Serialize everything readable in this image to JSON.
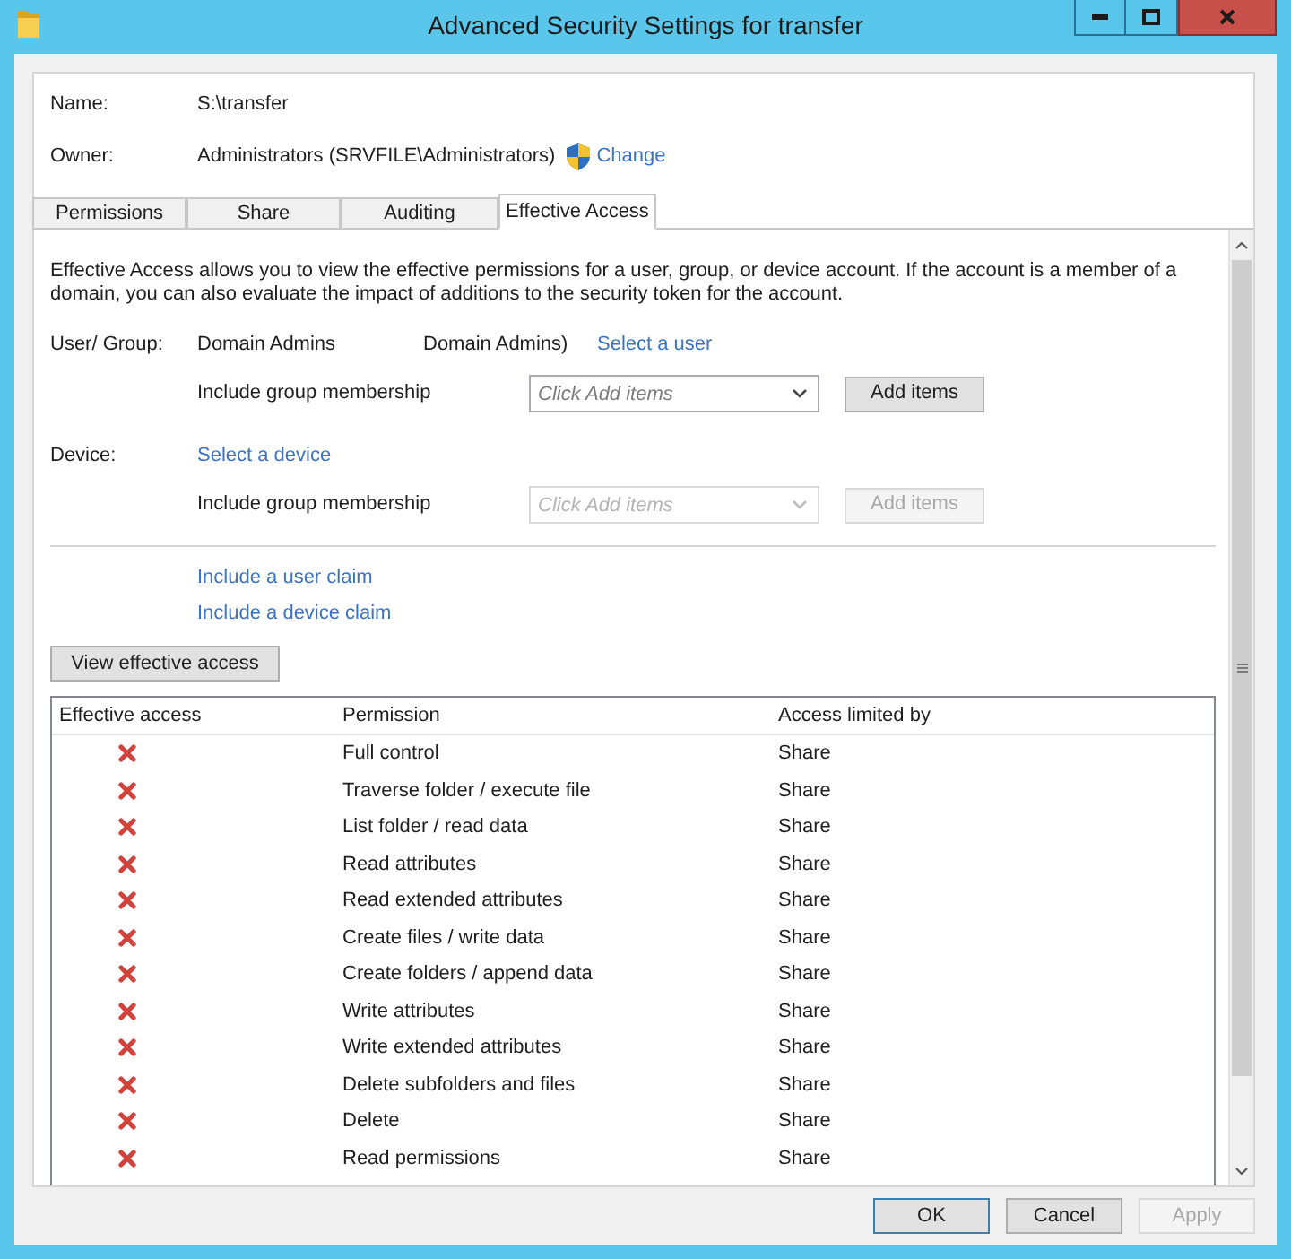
{
  "window": {
    "title": "Advanced Security Settings for transfer"
  },
  "object": {
    "name_label": "Name:",
    "name_value": "S:\\transfer",
    "owner_label": "Owner:",
    "owner_value": "Administrators (SRVFILE\\Administrators)",
    "change_link": "Change"
  },
  "tabs": [
    {
      "label": "Permissions",
      "selected": false
    },
    {
      "label": "Share",
      "selected": false
    },
    {
      "label": "Auditing",
      "selected": false
    },
    {
      "label": "Effective Access",
      "selected": true
    }
  ],
  "effective_access": {
    "description": "Effective Access allows you to view the effective permissions for a user, group, or device account. If the account is a member of a domain, you can also evaluate the impact of additions to the security token for the account.",
    "principals": [
      {
        "label": "User/ Group:",
        "value": "Domain Admins",
        "value_2": "Domain Admins)",
        "link": "Select a user",
        "membership": {
          "label": "Include group membership",
          "placeholder": "Click Add items",
          "button": "Add items",
          "disabled": false
        }
      },
      {
        "label": "Device:",
        "link": "Select a device",
        "membership": {
          "label": "Include group membership",
          "placeholder": "Click Add items",
          "button": "Add items",
          "disabled": true
        }
      }
    ],
    "claim_links": [
      "Include a user claim",
      "Include a device claim"
    ],
    "view_button": "View effective access",
    "table": {
      "columns": [
        "Effective access",
        "Permission",
        "Access limited by"
      ],
      "rows": [
        {
          "allowed": false,
          "permission": "Full control",
          "limited_by": "Share"
        },
        {
          "allowed": false,
          "permission": "Traverse folder / execute file",
          "limited_by": "Share"
        },
        {
          "allowed": false,
          "permission": "List folder / read data",
          "limited_by": "Share"
        },
        {
          "allowed": false,
          "permission": "Read attributes",
          "limited_by": "Share"
        },
        {
          "allowed": false,
          "permission": "Read extended attributes",
          "limited_by": "Share"
        },
        {
          "allowed": false,
          "permission": "Create files / write data",
          "limited_by": "Share"
        },
        {
          "allowed": false,
          "permission": "Create folders / append data",
          "limited_by": "Share"
        },
        {
          "allowed": false,
          "permission": "Write attributes",
          "limited_by": "Share"
        },
        {
          "allowed": false,
          "permission": "Write extended attributes",
          "limited_by": "Share"
        },
        {
          "allowed": false,
          "permission": "Delete subfolders and files",
          "limited_by": "Share"
        },
        {
          "allowed": false,
          "permission": "Delete",
          "limited_by": "Share"
        },
        {
          "allowed": false,
          "permission": "Read permissions",
          "limited_by": "Share"
        }
      ]
    }
  },
  "buttons": [
    {
      "label": "OK",
      "default": true,
      "disabled": false
    },
    {
      "label": "Cancel",
      "default": false,
      "disabled": false
    },
    {
      "label": "Apply",
      "default": false,
      "disabled": true
    }
  ]
}
